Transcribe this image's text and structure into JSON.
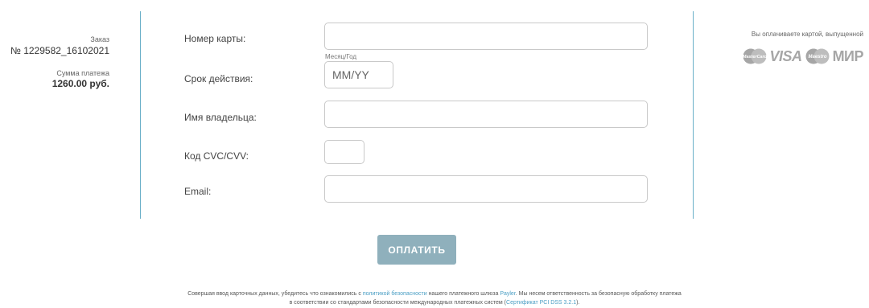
{
  "order": {
    "label": "Заказ",
    "number": "№ 1229582_16102021",
    "sum_label": "Сумма платежа",
    "sum": "1260.00 руб."
  },
  "form": {
    "card_number_label": "Номер карты:",
    "expiry_label": "Срок действия:",
    "expiry_hint": "Месяц/Год",
    "expiry_placeholder": "MM/YY",
    "holder_label": "Имя владельца:",
    "cvc_label": "Код CVC/CVV:",
    "email_label": "Email:"
  },
  "issuer": {
    "text": "Вы оплачиваете картой, выпущенной",
    "logos": [
      "mastercard-logo",
      "visa-logo",
      "maestro-logo",
      "mir-logo"
    ],
    "mastercard": "MasterCard",
    "visa": "VISA",
    "maestro": "Maestro",
    "mir": "МИР"
  },
  "pay_button": "ОПЛАТИТЬ",
  "footer": {
    "p1": "Совершая ввод карточных данных, убедитесь что ознакомились с ",
    "link_policy": "политикой безопасности",
    "p2": " нашего платежного шлюза ",
    "link_payler": "Payler",
    "p3": ". Мы несем ответственность за безопасную обработку платежа",
    "p4": "в соответствии со стандартами безопасности международных платежных систем (",
    "link_cert": "Сертификат PCI DSS 3.2.1",
    "p5": ")."
  },
  "colors": {
    "accent_line": "#6ab0c8",
    "button": "#8fb0bc",
    "link": "#4a9ec4",
    "logo_grey": "#a6a6a6"
  }
}
